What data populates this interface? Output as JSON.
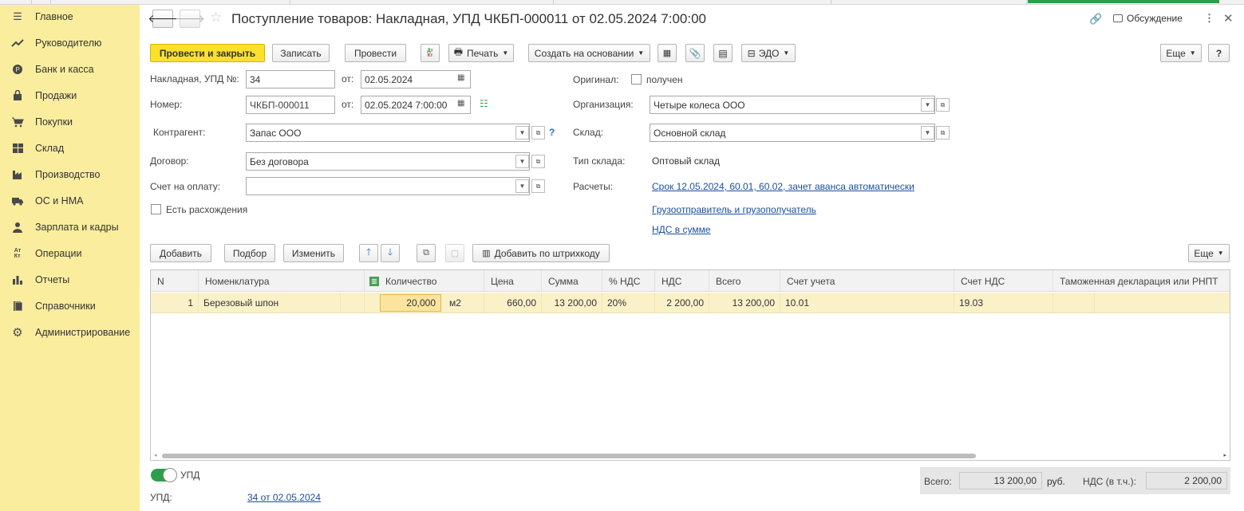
{
  "sidebar": {
    "items": [
      {
        "label": "Главное",
        "icon": "menu-lines-icon"
      },
      {
        "label": "Руководителю",
        "icon": "trend-chart-icon"
      },
      {
        "label": "Банк и касса",
        "icon": "coin-icon"
      },
      {
        "label": "Продажи",
        "icon": "shopping-bag-icon"
      },
      {
        "label": "Покупки",
        "icon": "cart-icon"
      },
      {
        "label": "Склад",
        "icon": "warehouse-icon"
      },
      {
        "label": "Производство",
        "icon": "factory-icon"
      },
      {
        "label": "ОС и НМА",
        "icon": "truck-icon"
      },
      {
        "label": "Зарплата и кадры",
        "icon": "person-icon"
      },
      {
        "label": "Операции",
        "icon": "dt-kt-icon"
      },
      {
        "label": "Отчеты",
        "icon": "bar-chart-icon"
      },
      {
        "label": "Справочники",
        "icon": "books-icon"
      },
      {
        "label": "Администрирование",
        "icon": "gear-icon"
      }
    ]
  },
  "header": {
    "title": "Поступление товаров: Накладная, УПД ЧКБП-000011 от 02.05.2024 7:00:00",
    "discussion": "Обсуждение"
  },
  "toolbar": {
    "post_close": "Провести и закрыть",
    "save": "Записать",
    "post": "Провести",
    "dtkt": "Дт Кт",
    "print": "Печать",
    "create_based": "Создать на основании",
    "edo": "ЭДО",
    "more": "Еще",
    "help": "?"
  },
  "form": {
    "invoice_label": "Накладная, УПД №:",
    "invoice_no": "34",
    "from_label": "от:",
    "invoice_date": "02.05.2024",
    "number_label": "Номер:",
    "number": "ЧКБП-000011",
    "number_date": "02.05.2024  7:00:00",
    "counterparty_label": "Контрагент:",
    "counterparty": "Запас ООО",
    "contract_label": "Договор:",
    "contract": "Без договора",
    "invoice_pay_label": "Счет на оплату:",
    "invoice_pay": "",
    "discrepancy_label": "Есть расхождения",
    "original_label": "Оригинал:",
    "original_received": "получен",
    "org_label": "Организация:",
    "org": "Четыре колеса ООО",
    "warehouse_label": "Склад:",
    "warehouse": "Основной склад",
    "wh_type_label": "Тип склада:",
    "wh_type": "Оптовый склад",
    "settlements_label": "Расчеты:",
    "settlements_link": "Срок 12.05.2024, 60.01, 60.02, зачет аванса автоматически",
    "shipper_link": "Грузоотправитель и грузополучатель",
    "vat_link": "НДС в сумме"
  },
  "table_toolbar": {
    "add": "Добавить",
    "pick": "Подбор",
    "change": "Изменить",
    "barcode": "Добавить по штрихкоду",
    "more": "Еще"
  },
  "table": {
    "headers": [
      "N",
      "Номенклатура",
      "Количество",
      "Цена",
      "Сумма",
      "% НДС",
      "НДС",
      "Всего",
      "Счет учета",
      "Счет НДС",
      "Таможенная декларация или РНПТ"
    ],
    "rows": [
      {
        "n": "1",
        "item": "Березовый шпон",
        "qty": "20,000",
        "unit": "м2",
        "price": "660,00",
        "sum": "13 200,00",
        "vat_rate": "20%",
        "vat": "2 200,00",
        "total": "13 200,00",
        "account": "10.01",
        "vat_account": "19.03",
        "customs": ""
      }
    ]
  },
  "footer": {
    "upd_toggle": "УПД",
    "upd_label": "УПД:",
    "upd_link": "34 от 02.05.2024",
    "total_label": "Всего:",
    "total_value": "13 200,00",
    "currency": "руб.",
    "vat_label": "НДС (в т.ч.):",
    "vat_value": "2 200,00"
  }
}
